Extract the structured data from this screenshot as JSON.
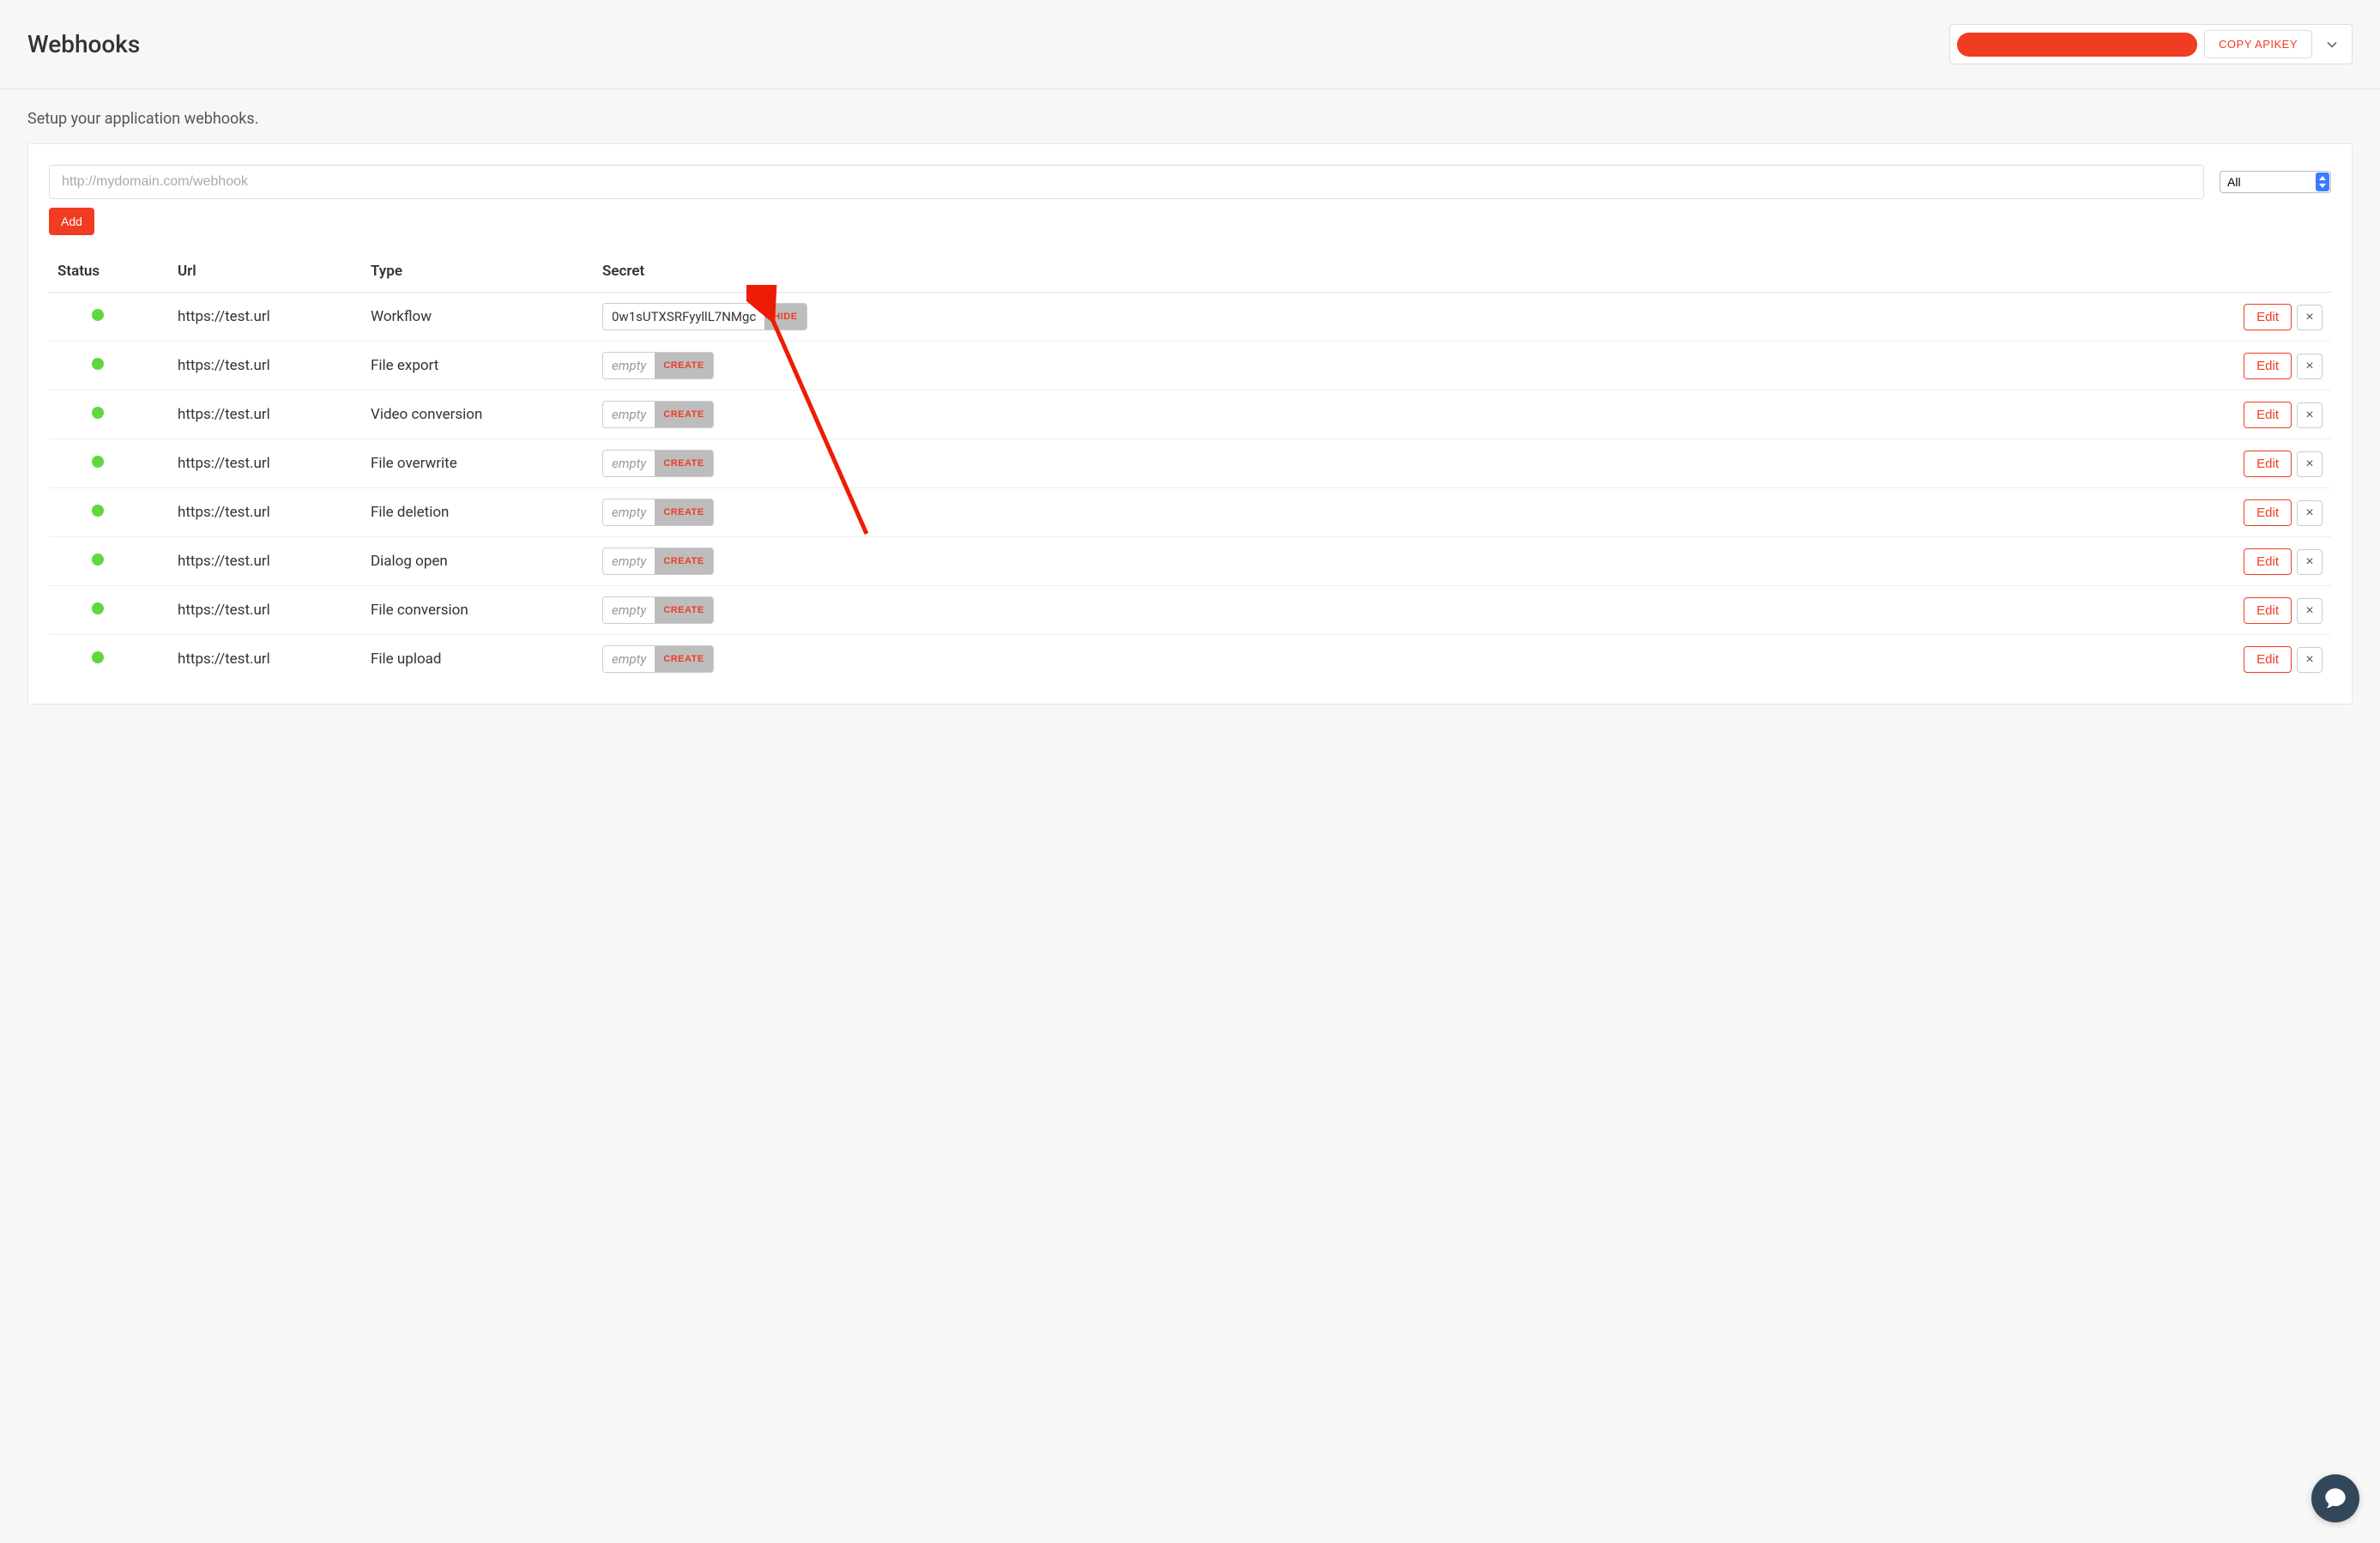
{
  "page_title": "Webhooks",
  "copy_apikey_label": "COPY APIKEY",
  "subtitle": "Setup your application webhooks.",
  "url_placeholder": "http://mydomain.com/webhook",
  "type_selected": "All",
  "add_label": "Add",
  "columns": {
    "status": "Status",
    "url": "Url",
    "type": "Type",
    "secret": "Secret"
  },
  "edit_label": "Edit",
  "hide_label": "HIDE",
  "create_label": "CREATE",
  "empty_label": "empty",
  "rows": [
    {
      "url": "https://test.url",
      "type": "Workflow",
      "secret": "0w1sUTXSRFyyllL7NMgc",
      "secret_state": "shown"
    },
    {
      "url": "https://test.url",
      "type": "File export",
      "secret": "",
      "secret_state": "empty"
    },
    {
      "url": "https://test.url",
      "type": "Video conversion",
      "secret": "",
      "secret_state": "empty"
    },
    {
      "url": "https://test.url",
      "type": "File overwrite",
      "secret": "",
      "secret_state": "empty"
    },
    {
      "url": "https://test.url",
      "type": "File deletion",
      "secret": "",
      "secret_state": "empty"
    },
    {
      "url": "https://test.url",
      "type": "Dialog open",
      "secret": "",
      "secret_state": "empty"
    },
    {
      "url": "https://test.url",
      "type": "File conversion",
      "secret": "",
      "secret_state": "empty"
    },
    {
      "url": "https://test.url",
      "type": "File upload",
      "secret": "",
      "secret_state": "empty"
    }
  ],
  "colors": {
    "accent": "#ef3c23",
    "status_ok": "#5fd83f"
  }
}
